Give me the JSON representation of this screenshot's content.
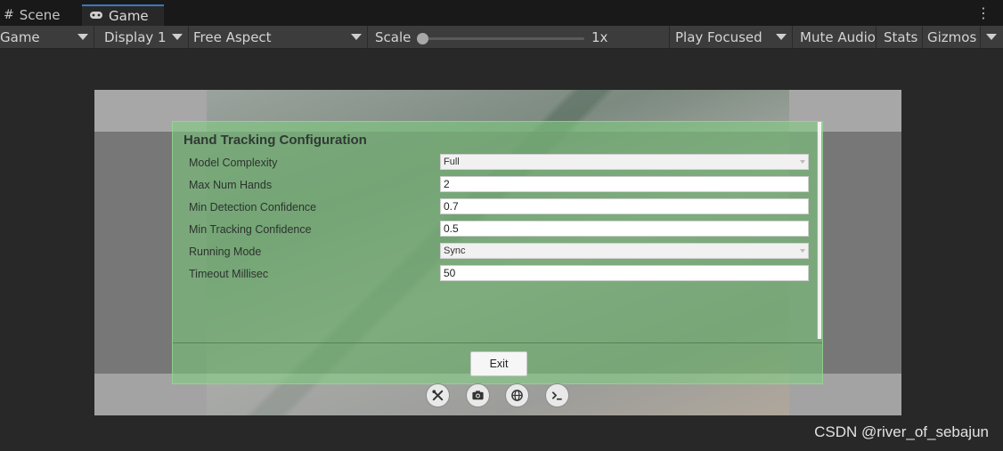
{
  "tabs": {
    "scene": "Scene",
    "game": "Game"
  },
  "toolbar": {
    "game_dropdown": "Game",
    "display": "Display 1",
    "aspect": "Free Aspect",
    "scale_label": "Scale",
    "scale_value": "1x",
    "play_mode": "Play Focused",
    "mute_audio": "Mute Audio",
    "stats": "Stats",
    "gizmos": "Gizmos"
  },
  "panel": {
    "title": "Hand Tracking Configuration",
    "fields": [
      {
        "label": "Model Complexity",
        "value": "Full",
        "type": "dropdown"
      },
      {
        "label": "Max Num Hands",
        "value": "2",
        "type": "input"
      },
      {
        "label": "Min Detection Confidence",
        "value": "0.7",
        "type": "input"
      },
      {
        "label": "Min Tracking Confidence",
        "value": "0.5",
        "type": "input"
      },
      {
        "label": "Running Mode",
        "value": "Sync",
        "type": "dropdown"
      },
      {
        "label": "Timeout Millisec",
        "value": "50",
        "type": "input"
      }
    ],
    "exit_label": "Exit"
  },
  "bottom_buttons": [
    "tools-icon",
    "camera-icon",
    "globe-icon",
    "console-icon"
  ],
  "watermark": "CSDN @river_of_sebajun"
}
